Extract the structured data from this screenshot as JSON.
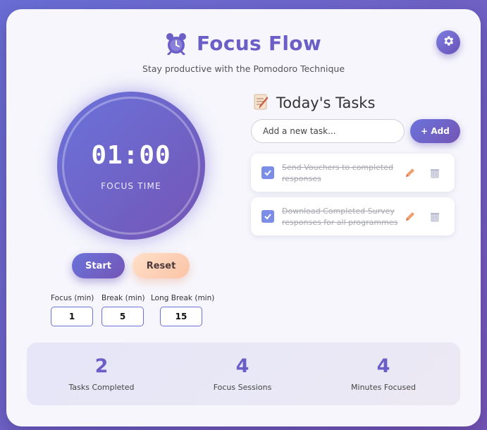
{
  "app": {
    "title": "Focus Flow",
    "subtitle": "Stay productive with the Pomodoro Technique",
    "icons": {
      "logo": "alarm-clock-icon",
      "settings": "gear-icon"
    }
  },
  "timer": {
    "time": "01:00",
    "mode_label": "FOCUS TIME",
    "start_label": "Start",
    "reset_label": "Reset"
  },
  "settings": [
    {
      "label": "Focus (min)",
      "value": "1"
    },
    {
      "label": "Break (min)",
      "value": "5"
    },
    {
      "label": "Long Break (min)",
      "value": "15"
    }
  ],
  "tasks": {
    "title": "Today's Tasks",
    "input_placeholder": "Add a new task...",
    "add_label": "+ Add",
    "items": [
      {
        "text": "Send Vouchers to completed responses",
        "completed": true
      },
      {
        "text": "Download Completed Survey responses for all programmes",
        "completed": true
      }
    ]
  },
  "stats": [
    {
      "value": "2",
      "label": "Tasks Completed"
    },
    {
      "value": "4",
      "label": "Focus Sessions"
    },
    {
      "value": "4",
      "label": "Minutes Focused"
    }
  ],
  "colors": {
    "accent": "#6b5fc7",
    "gradient_start": "#6a73db",
    "gradient_end": "#7455b5",
    "reset_button": "#fbc3a6",
    "checkbox": "#7c8de8"
  }
}
